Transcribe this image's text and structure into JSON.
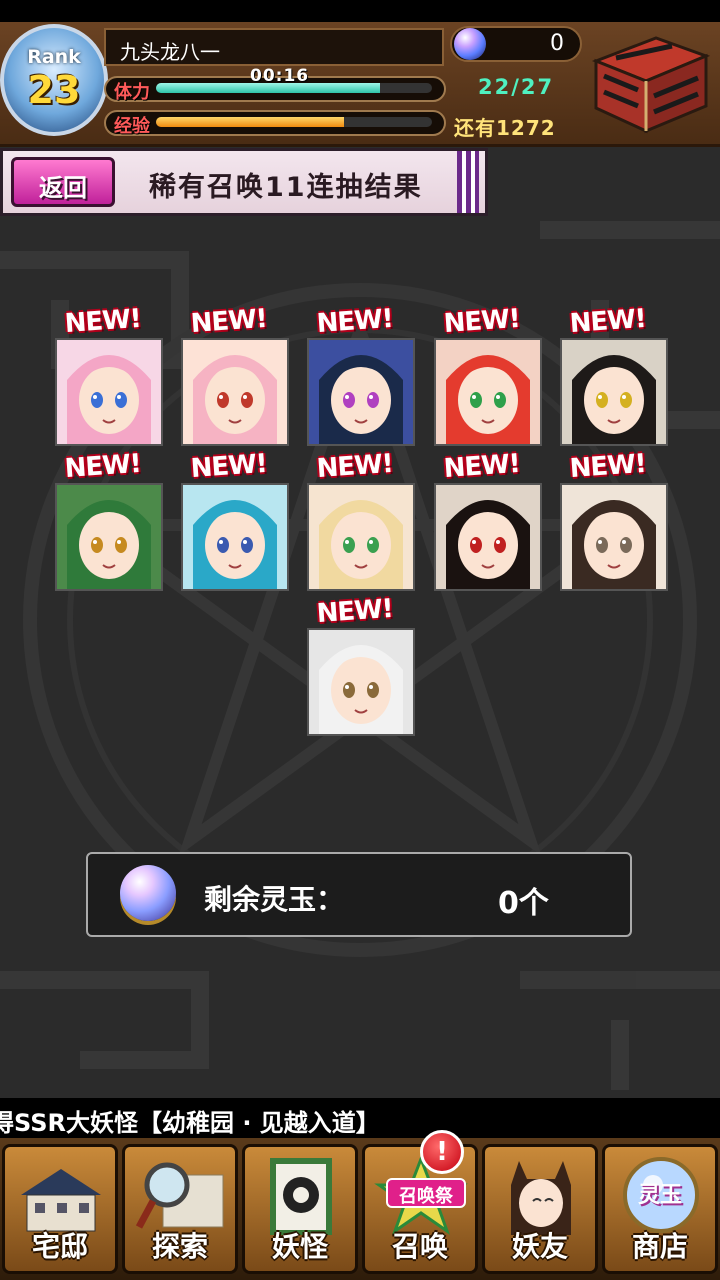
{
  "header": {
    "rank_label": "Rank",
    "rank_value": "23",
    "player_name": "九头龙八一",
    "stamina_label": "体力",
    "stamina_timer": "00:16",
    "stamina_fraction": 0.81,
    "exp_label": "经验",
    "exp_fraction": 0.68,
    "gem_count": "0",
    "stamina_count": "22/27",
    "exp_remaining": "还有1272"
  },
  "banner": {
    "back_label": "返回",
    "title": "稀有召唤11连抽结果"
  },
  "results": {
    "new_tag": "NEW!",
    "cards": [
      {
        "name": "pink-hair-girl",
        "hair": "#f4a6c6",
        "bg": "#f7d7e6",
        "eye": "#3a6fd6"
      },
      {
        "name": "pink-hair-smiling-girl",
        "hair": "#f6b3c3",
        "bg": "#fde2d6",
        "eye": "#c0392b"
      },
      {
        "name": "long-black-hair-ghost",
        "hair": "#1a2a4a",
        "bg": "#3c4fa0",
        "eye": "#b040c0"
      },
      {
        "name": "red-hair-winged-girl",
        "hair": "#e43b2e",
        "bg": "#f3d2c4",
        "eye": "#2ea04a"
      },
      {
        "name": "black-hair-yellow-eyes",
        "hair": "#1e1a18",
        "bg": "#d9d2c6",
        "eye": "#d4b020"
      },
      {
        "name": "green-hair-boy",
        "hair": "#2f7a3a",
        "bg": "#4c8a4a",
        "eye": "#c68a20"
      },
      {
        "name": "blue-hair-girl",
        "hair": "#2aa8c8",
        "bg": "#b8e6f0",
        "eye": "#3a5ab0"
      },
      {
        "name": "blonde-flower-girl",
        "hair": "#f1d9a0",
        "bg": "#f6e4d0",
        "eye": "#3aa050"
      },
      {
        "name": "black-hair-red-eyes",
        "hair": "#1a1210",
        "bg": "#e0d4c8",
        "eye": "#c02020"
      },
      {
        "name": "bob-hair-candy-girl",
        "hair": "#3a2a22",
        "bg": "#efe4d8",
        "eye": "#7a6a5a"
      },
      {
        "name": "white-hood-girl",
        "hair": "#f2f2f2",
        "bg": "#e6e6e6",
        "eye": "#8a6a3a"
      }
    ]
  },
  "remaining": {
    "label": "剩余灵玉：",
    "value": "0个"
  },
  "ticker": {
    "text": "得SSR大妖怪【幼稚园 · 见越入道】"
  },
  "nav": {
    "items": [
      {
        "label": "宅邸",
        "icon": "house-icon"
      },
      {
        "label": "探索",
        "icon": "magnifier-map-icon"
      },
      {
        "label": "妖怪",
        "icon": "scroll-icon"
      },
      {
        "label": "召唤",
        "icon": "star-summon-icon"
      },
      {
        "label": "妖友",
        "icon": "catgirl-friend-icon"
      },
      {
        "label": "商店",
        "icon": "gem-shop-icon"
      }
    ],
    "alert_mark": "!",
    "festival_tag": "召唤祭",
    "shop_orb_label": "灵玉"
  }
}
